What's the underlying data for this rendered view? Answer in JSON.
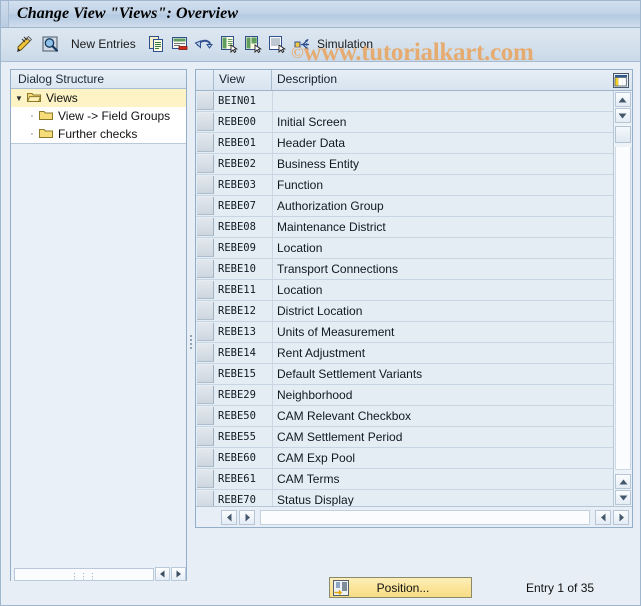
{
  "window": {
    "title": "Change View \"Views\": Overview"
  },
  "toolbar": {
    "items": [
      {
        "name": "change-display-icon",
        "label": ""
      },
      {
        "name": "display-details-icon",
        "label": ""
      },
      {
        "name": "new-entries-button",
        "label": "New Entries"
      },
      {
        "name": "copy-icon",
        "label": ""
      },
      {
        "name": "delete-icon",
        "label": ""
      },
      {
        "name": "undo-icon",
        "label": ""
      },
      {
        "name": "select-all-icon",
        "label": ""
      },
      {
        "name": "select-block-icon",
        "label": ""
      },
      {
        "name": "deselect-all-icon",
        "label": ""
      },
      {
        "name": "simulation-icon",
        "label": ""
      },
      {
        "name": "simulation-button",
        "label": "Simulation"
      }
    ],
    "new_entries_label": "New Entries",
    "simulation_label": "Simulation"
  },
  "watermark": {
    "copyright": "©",
    "text": "www.tutorialkart.com"
  },
  "sidebar": {
    "header": "Dialog Structure",
    "items": [
      {
        "label": "Views",
        "level": 0,
        "selected": true,
        "expanded": true
      },
      {
        "label": "View -> Field Groups",
        "level": 1,
        "selected": false
      },
      {
        "label": "Further checks",
        "level": 1,
        "selected": false
      }
    ]
  },
  "table": {
    "columns": [
      "View",
      "Description"
    ],
    "rows": [
      {
        "view": "BEIN01",
        "description": ""
      },
      {
        "view": "REBE00",
        "description": "Initial Screen"
      },
      {
        "view": "REBE01",
        "description": "Header Data"
      },
      {
        "view": "REBE02",
        "description": "Business Entity"
      },
      {
        "view": "REBE03",
        "description": "Function"
      },
      {
        "view": "REBE07",
        "description": "Authorization Group"
      },
      {
        "view": "REBE08",
        "description": "Maintenance District"
      },
      {
        "view": "REBE09",
        "description": "Location"
      },
      {
        "view": "REBE10",
        "description": "Transport Connections"
      },
      {
        "view": "REBE11",
        "description": "Location"
      },
      {
        "view": "REBE12",
        "description": "District Location"
      },
      {
        "view": "REBE13",
        "description": "Units of Measurement"
      },
      {
        "view": "REBE14",
        "description": "Rent Adjustment"
      },
      {
        "view": "REBE15",
        "description": "Default Settlement Variants"
      },
      {
        "view": "REBE29",
        "description": "Neighborhood"
      },
      {
        "view": "REBE50",
        "description": "CAM Relevant Checkbox"
      },
      {
        "view": "REBE55",
        "description": "CAM Settlement Period"
      },
      {
        "view": "REBE60",
        "description": "CAM Exp Pool"
      },
      {
        "view": "REBE61",
        "description": "CAM Terms"
      },
      {
        "view": "REBE70",
        "description": "Status Display"
      }
    ]
  },
  "footer": {
    "position_button": "Position...",
    "entry_status": "Entry 1 of 35"
  },
  "colors": {
    "title_bar": "#c2d4e8",
    "selection_yellow": "#fdf3c4",
    "button_yellow": "#fbe59a",
    "watermark_orange": "#e8a766",
    "table_row": "#e4ecf4",
    "border": "#93aec9"
  }
}
